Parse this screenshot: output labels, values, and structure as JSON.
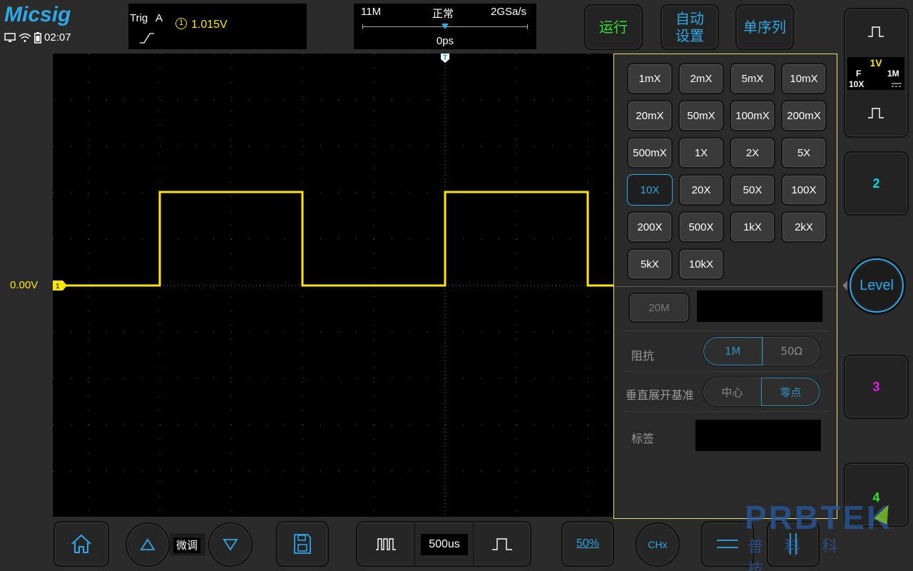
{
  "brand": {
    "logo": "Micsig",
    "clock": "02:07"
  },
  "trigger": {
    "label": "Trig",
    "mode": "A",
    "source": "1",
    "level": "1.015V"
  },
  "timebase": {
    "memory": "11M",
    "mode": "正常",
    "sample_rate": "2GSa/s",
    "offset": "0ps"
  },
  "top_buttons": {
    "run": "运行",
    "auto": "自动\n设置",
    "single": "单序列"
  },
  "channel1": {
    "offset_label": "0.00V",
    "marker": "1",
    "scale": "1V",
    "coupling_code": "F",
    "impedance": "1M",
    "probe": "10X",
    "color": "#ffe600"
  },
  "probe_panel": {
    "options": [
      "1mX",
      "2mX",
      "5mX",
      "10mX",
      "20mX",
      "50mX",
      "100mX",
      "200mX",
      "500mX",
      "1X",
      "2X",
      "5X",
      "10X",
      "20X",
      "50X",
      "100X",
      "200X",
      "500X",
      "1kX",
      "2kX",
      "5kX",
      "10kX"
    ],
    "selected": "10X",
    "bandwidth": "20M",
    "impedance_label": "阻抗",
    "impedance_options": [
      "1M",
      "50Ω"
    ],
    "impedance_selected": "1M",
    "expand_label": "垂直展开基准",
    "expand_options": [
      "中心",
      "零点"
    ],
    "expand_selected": "零点",
    "tag_label": "标签"
  },
  "side_channels": {
    "ch2": "2",
    "ch3": "3",
    "ch4": "4",
    "level": "Level"
  },
  "bottom_bar": {
    "fine": "微调",
    "timebase": "500us",
    "fifty": "50%",
    "chx": "CHx"
  },
  "watermark": {
    "brand": "PRBTEK",
    "cn": "普科科技"
  },
  "colors": {
    "accent": "#2ea8e6",
    "ch1": "#ffe600",
    "ch2": "#00d8e8",
    "ch3": "#e020e0",
    "ch4": "#30e030"
  }
}
